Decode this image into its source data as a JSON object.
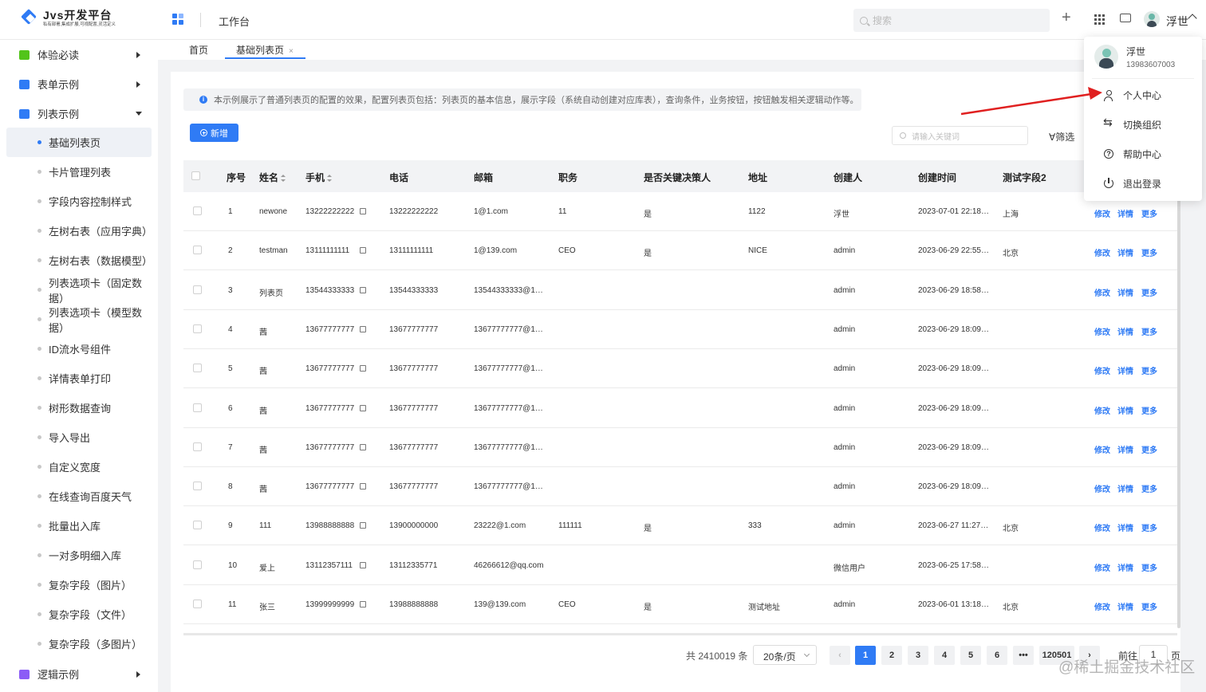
{
  "header": {
    "logo_title": "Jvs开发平台",
    "logo_subtitle": "私有部署,集成扩展,可视配置,灵活定义",
    "workbench": "工作台",
    "search_placeholder": "搜索",
    "user_name": "浮世"
  },
  "sidebar": {
    "groups": [
      {
        "label": "体验必读",
        "icon_color": "#52c41a"
      },
      {
        "label": "表单示例",
        "icon_color": "#2f7bf5"
      },
      {
        "label": "列表示例",
        "icon_color": "#2f7bf5"
      },
      {
        "label": "逻辑示例",
        "icon_color": "#8b5cf6"
      }
    ],
    "items": [
      "基础列表页",
      "卡片管理列表",
      "字段内容控制样式",
      "左树右表（应用字典）",
      "左树右表（数据模型）",
      "列表选项卡（固定数据）",
      "列表选项卡（模型数据）",
      "ID流水号组件",
      "详情表单打印",
      "树形数据查询",
      "导入导出",
      "自定义宽度",
      "在线查询百度天气",
      "批量出入库",
      "一对多明细入库",
      "复杂字段（图片）",
      "复杂字段（文件）",
      "复杂字段（多图片）"
    ]
  },
  "tabs": [
    {
      "label": "首页"
    },
    {
      "label": "基础列表页",
      "close": "×"
    }
  ],
  "notice": "本示例展示了普通列表页的配置的效果，配置列表页包括：列表页的基本信息，展示字段（系统自动创建对应库表），查询条件，业务按钮，按钮触发相关逻辑动作等。",
  "toolbar": {
    "add_label": "新增",
    "keyword_placeholder": "请输入关键词",
    "filter_label": "筛选"
  },
  "table": {
    "columns": [
      "序号",
      "姓名",
      "手机",
      "电话",
      "邮箱",
      "职务",
      "是否关键决策人",
      "地址",
      "创建人",
      "创建时间",
      "测试字段2"
    ],
    "actions": [
      "修改",
      "详情",
      "更多"
    ],
    "rows": [
      [
        "1",
        "newone",
        "13222222222",
        "13222222222",
        "1@1.com",
        "11",
        "是",
        "1122",
        "浮世",
        "2023-07-01 22:18…",
        "上海"
      ],
      [
        "2",
        "testman",
        "13111111111",
        "13111111111",
        "1@139.com",
        "CEO",
        "是",
        "NICE",
        "admin",
        "2023-06-29 22:55…",
        "北京"
      ],
      [
        "3",
        "列表页",
        "13544333333",
        "13544333333",
        "13544333333@1…",
        "",
        "",
        "",
        "admin",
        "2023-06-29 18:58…",
        ""
      ],
      [
        "4",
        "茜",
        "13677777777",
        "13677777777",
        "13677777777@1…",
        "",
        "",
        "",
        "admin",
        "2023-06-29 18:09…",
        ""
      ],
      [
        "5",
        "茜",
        "13677777777",
        "13677777777",
        "13677777777@1…",
        "",
        "",
        "",
        "admin",
        "2023-06-29 18:09…",
        ""
      ],
      [
        "6",
        "茜",
        "13677777777",
        "13677777777",
        "13677777777@1…",
        "",
        "",
        "",
        "admin",
        "2023-06-29 18:09…",
        ""
      ],
      [
        "7",
        "茜",
        "13677777777",
        "13677777777",
        "13677777777@1…",
        "",
        "",
        "",
        "admin",
        "2023-06-29 18:09…",
        ""
      ],
      [
        "8",
        "茜",
        "13677777777",
        "13677777777",
        "13677777777@1…",
        "",
        "",
        "",
        "admin",
        "2023-06-29 18:09…",
        ""
      ],
      [
        "9",
        "111",
        "13988888888",
        "13900000000",
        "23222@1.com",
        "111111",
        "是",
        "333",
        "admin",
        "2023-06-27 11:27…",
        "北京"
      ],
      [
        "10",
        "爱上",
        "13112357111",
        "13112335771",
        "46266612@qq.com",
        "",
        "",
        "",
        "微信用户",
        "2023-06-25 17:58…",
        ""
      ],
      [
        "11",
        "张三",
        "13999999999",
        "13988888888",
        "139@139.com",
        "CEO",
        "是",
        "测试地址",
        "admin",
        "2023-06-01 13:18…",
        "北京"
      ]
    ]
  },
  "pagination": {
    "total": "共 2410019 条",
    "page_size": "20条/页",
    "pages": [
      "1",
      "2",
      "3",
      "4",
      "5",
      "6",
      "•••",
      "120501"
    ],
    "prev": "‹",
    "next": "›",
    "goto_label": "前往",
    "goto_value": "1",
    "page_unit": "页"
  },
  "user_menu": {
    "name": "浮世",
    "phone": "13983607003",
    "items": [
      "个人中心",
      "切换组织",
      "帮助中心",
      "退出登录"
    ]
  },
  "watermark": "@稀土掘金技术社区",
  "colors": {
    "accent": "#2f7bf5",
    "arrow": "#e02020"
  }
}
